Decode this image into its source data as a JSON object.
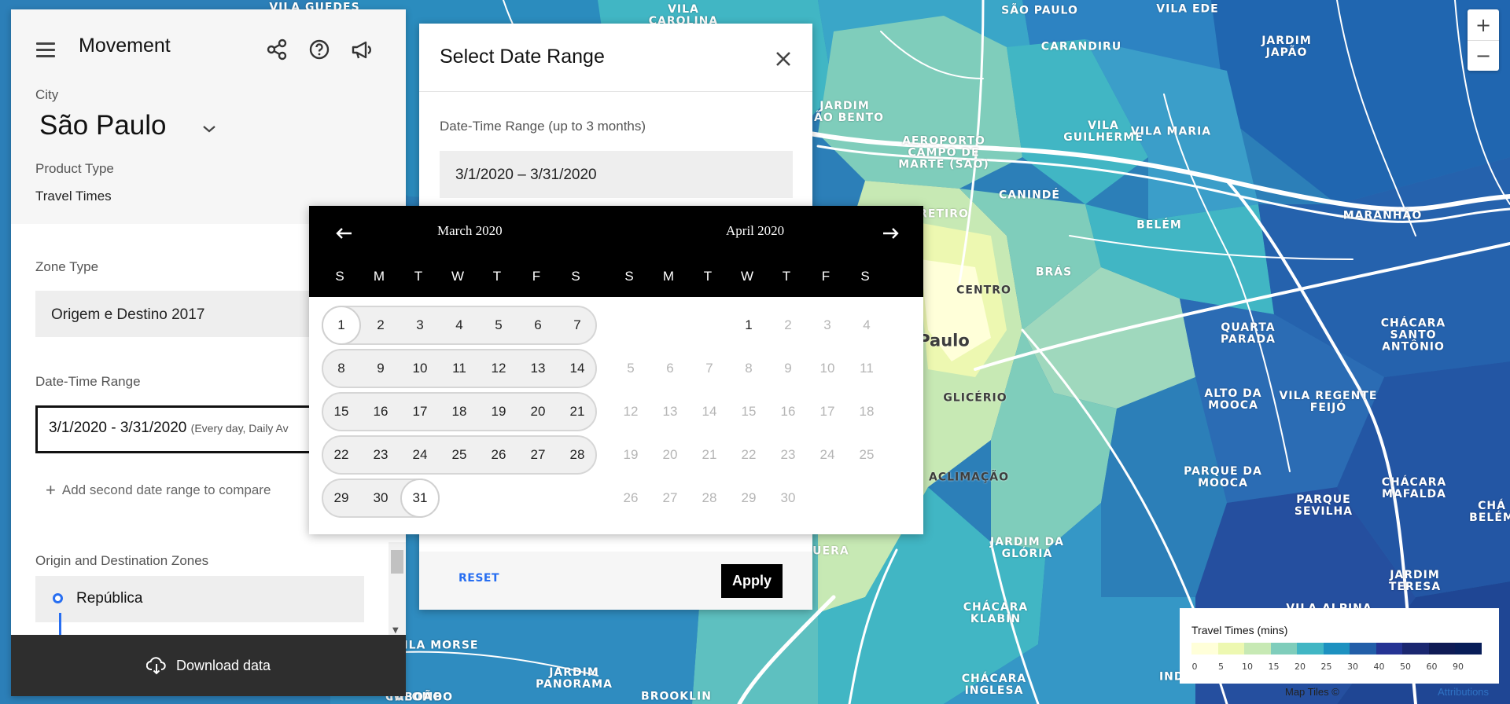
{
  "panel": {
    "title": "Movement",
    "city_label": "City",
    "city_value": "São Paulo",
    "product_type_label": "Product Type",
    "product_type_value": "Travel Times",
    "zone_type_label": "Zone Type",
    "zone_type_value": "Origem e Destino 2017",
    "date_range_label": "Date-Time Range",
    "date_range_value": "3/1/2020 - 3/31/2020",
    "date_range_note": "(Every day, Daily Av",
    "add_range_label": "Add second date range to compare",
    "zones_label": "Origin and Destination Zones",
    "zone_origin": "República",
    "download_label": "Download data",
    "icons": [
      "hamburger-icon",
      "share-icon",
      "help-icon",
      "megaphone-icon",
      "chevron-down-icon",
      "cloud-download-icon"
    ]
  },
  "dialog": {
    "title": "Select Date Range",
    "range_label": "Date-Time Range (up to 3 months)",
    "range_value": "3/1/2020 – 3/31/2020",
    "reset_label": "RESET",
    "apply_label": "Apply"
  },
  "calendar": {
    "left_month": "March 2020",
    "right_month": "April 2020",
    "weekdays": [
      "S",
      "M",
      "T",
      "W",
      "T",
      "F",
      "S"
    ],
    "left_first_weekday": 0,
    "left_days": 31,
    "right_first_weekday": 3,
    "right_days": 30,
    "selected_start": 1,
    "selected_end": 31
  },
  "legend": {
    "title": "Travel Times (mins)",
    "ticks": [
      "0",
      "5",
      "10",
      "15",
      "20",
      "25",
      "30",
      "40",
      "50",
      "60",
      "90"
    ],
    "colors": [
      "#ffffd9",
      "#edf8b1",
      "#c7e9b4",
      "#7fcdbb",
      "#41b6c4",
      "#1d91c0",
      "#225ea8",
      "#253494",
      "#1a2770",
      "#0f1b55",
      "#081d58"
    ],
    "map_tiles": "Map Tiles ©",
    "attribution": "Attributions"
  },
  "map_labels": [
    "VILA GUEDES",
    "VILA\nCAROLINA",
    "SÃO PAULO",
    "VILA EDE",
    "JARDIM\nSÃO BENTO",
    "CARANDIRU",
    "JARDIM\nJAPÃO",
    "Aeroporto\nCampo de\nMarte (SAO)",
    "VILA\nGUILHERME",
    "VILA MARIA",
    "CANINDÉ",
    "BELÉM",
    "MARANHÃO",
    "RETIRO",
    "CENTRO",
    "BRÁS",
    "Paulo",
    "QUARTA\nPARADA",
    "CHÁCARA\nSANTO\nANTÔNIO",
    "GLICÉRIO",
    "ALTO DA\nMOOCA",
    "VILA REGENTE\nFEIJÓ",
    "ACLIMAÇÃO",
    "PARQUE DA\nMOOCA",
    "CHÁCARA\nMAFALDA",
    "PARQUE\nSEVILHA",
    "JARDIM DA\nGLÓRIA",
    "JARDIM\nTERESA",
    "VILA ALPINA",
    "CHÁCARA\nKLABIN",
    "CHÁCARA\nINGLESA",
    "JARDIM\nPANORAMA",
    "BROOKLIN",
    "COLOMBO",
    "VILA MORSE",
    "Taboão",
    "ESPUERA",
    "CHÁ\nBELÉM",
    "INDE"
  ],
  "zoom": {
    "in": "+",
    "out": "−"
  }
}
